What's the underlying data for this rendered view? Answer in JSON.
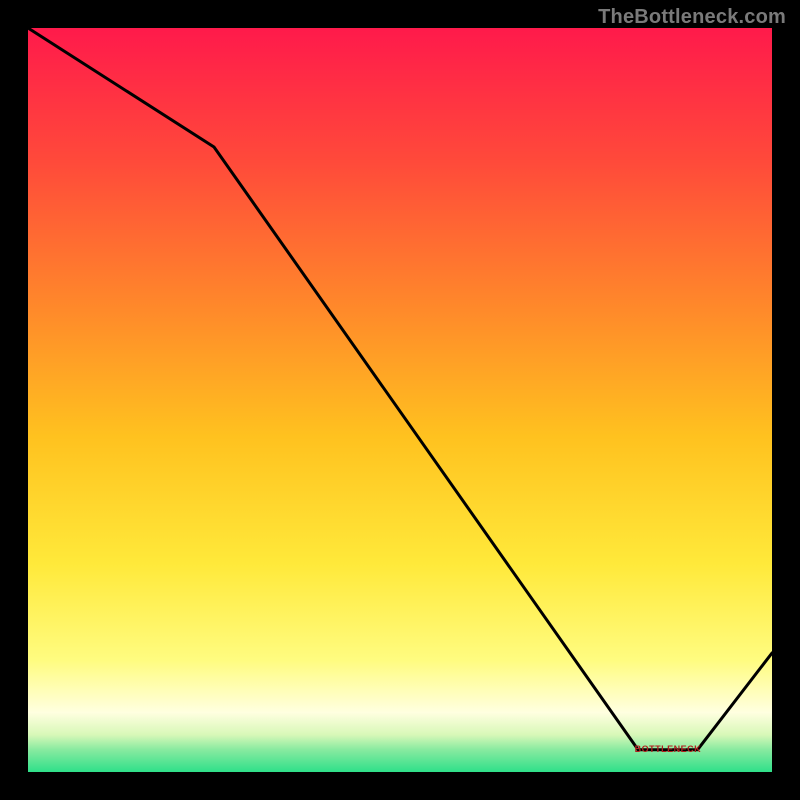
{
  "watermark": "TheBottleneck.com",
  "chart_data": {
    "type": "line",
    "title": "",
    "xlabel": "",
    "ylabel": "",
    "xlim": [
      0,
      100
    ],
    "ylim": [
      0,
      100
    ],
    "x": [
      0,
      25,
      82,
      90,
      100
    ],
    "values": [
      100,
      84,
      3,
      3,
      16
    ],
    "grid": false,
    "legend": false,
    "background_gradient": {
      "top": "#ff1a4b",
      "mid_upper": "#ff7a2a",
      "mid": "#ffd21f",
      "mid_lower": "#fff55a",
      "pale": "#ffffd0",
      "green": "#2fe08a"
    },
    "flat_segment_label": "BOTTLENECK"
  },
  "colors": {
    "frame": "#000000",
    "line": "#000000",
    "watermark": "#7a7a7a",
    "annotation": "#b02020"
  }
}
